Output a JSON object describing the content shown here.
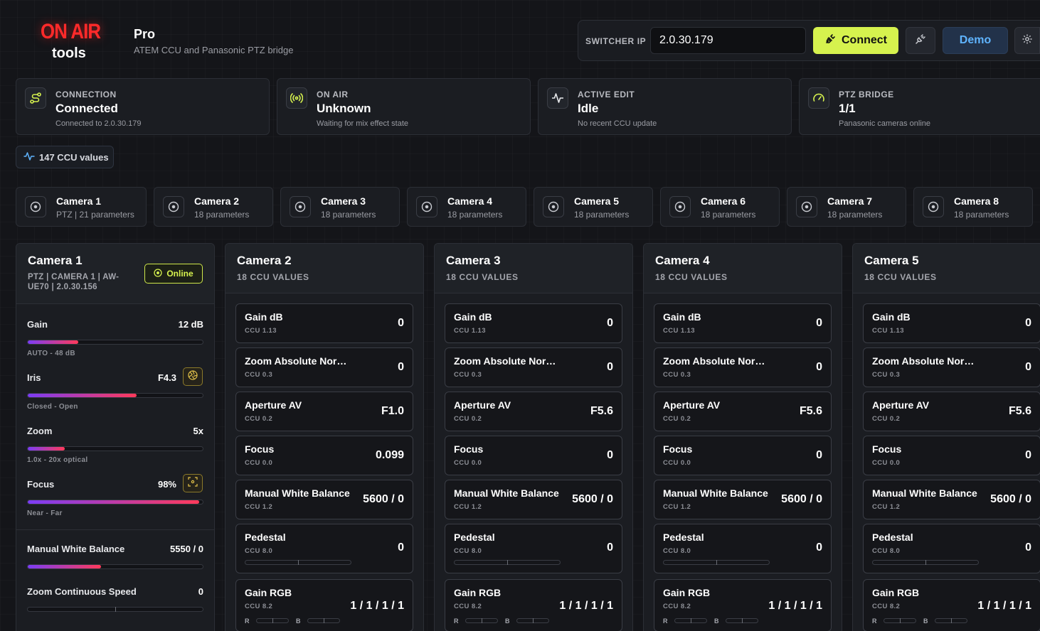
{
  "logo": {
    "top": "ON AIR",
    "bottom": "tools"
  },
  "app": {
    "title": "Pro",
    "subtitle": "ATEM CCU and Panasonic PTZ bridge"
  },
  "connection_bar": {
    "label": "SWITCHER IP",
    "ip_value": "2.0.30.179",
    "connect_label": "Connect",
    "demo_label": "Demo"
  },
  "status": [
    {
      "label": "CONNECTION",
      "value": "Connected",
      "sub": "Connected to 2.0.30.179",
      "icon": "route-icon"
    },
    {
      "label": "ON AIR",
      "value": "Unknown",
      "sub": "Waiting for mix effect state",
      "icon": "broadcast-icon"
    },
    {
      "label": "ACTIVE EDIT",
      "value": "Idle",
      "sub": "No recent CCU update",
      "icon": "activity-icon"
    },
    {
      "label": "PTZ BRIDGE",
      "value": "1/1",
      "sub": "Panasonic cameras online",
      "icon": "gauge-icon"
    }
  ],
  "ccu_count": "147 CCU values",
  "tabs": [
    {
      "name": "Camera 1",
      "params": "PTZ | 21 parameters"
    },
    {
      "name": "Camera 2",
      "params": "18 parameters"
    },
    {
      "name": "Camera 3",
      "params": "18 parameters"
    },
    {
      "name": "Camera 4",
      "params": "18 parameters"
    },
    {
      "name": "Camera 5",
      "params": "18 parameters"
    },
    {
      "name": "Camera 6",
      "params": "18 parameters"
    },
    {
      "name": "Camera 7",
      "params": "18 parameters"
    },
    {
      "name": "Camera 8",
      "params": "18 parameters"
    }
  ],
  "camera1": {
    "name": "Camera 1",
    "meta": "PTZ | CAMERA 1 | AW-UE70 | 2.0.30.156",
    "status": "Online",
    "controls": [
      {
        "label": "Gain",
        "value": "12 dB",
        "sub": "AUTO - 48 dB",
        "level": 0.29
      },
      {
        "label": "Iris",
        "value": "F4.3",
        "sub": "Closed - Open",
        "level": 0.62
      },
      {
        "label": "Zoom",
        "value": "5x",
        "sub": "1.0x - 20x optical",
        "level": 0.21
      },
      {
        "label": "Focus",
        "value": "98%",
        "sub": "Near - Far",
        "level": 0.98
      }
    ],
    "extra": [
      {
        "label": "Manual White Balance",
        "value": "5550 / 0",
        "level": 0.42
      },
      {
        "label": "Zoom Continuous Speed",
        "value": "0"
      }
    ]
  },
  "panels": [
    {
      "name": "Camera 2",
      "meta": "18 CCU VALUES",
      "rows": [
        {
          "name": "Gain dB",
          "ccu": "CCU 1.13",
          "value": "0"
        },
        {
          "name": "Zoom Absolute Normalized",
          "ccu": "CCU 0.3",
          "value": "0"
        },
        {
          "name": "Aperture AV",
          "ccu": "CCU 0.2",
          "value": "F1.0"
        },
        {
          "name": "Focus",
          "ccu": "CCU 0.0",
          "value": "0.099"
        },
        {
          "name": "Manual White Balance",
          "ccu": "CCU 1.2",
          "value": "5600 / 0"
        },
        {
          "name": "Pedestal",
          "ccu": "CCU 8.0",
          "value": "0"
        },
        {
          "name": "Gain RGB",
          "ccu": "CCU 8.2",
          "value": "1 / 1 / 1 / 1"
        }
      ]
    },
    {
      "name": "Camera 3",
      "meta": "18 CCU VALUES",
      "rows": [
        {
          "name": "Gain dB",
          "ccu": "CCU 1.13",
          "value": "0"
        },
        {
          "name": "Zoom Absolute Normalized",
          "ccu": "CCU 0.3",
          "value": "0"
        },
        {
          "name": "Aperture AV",
          "ccu": "CCU 0.2",
          "value": "F5.6"
        },
        {
          "name": "Focus",
          "ccu": "CCU 0.0",
          "value": "0"
        },
        {
          "name": "Manual White Balance",
          "ccu": "CCU 1.2",
          "value": "5600 / 0"
        },
        {
          "name": "Pedestal",
          "ccu": "CCU 8.0",
          "value": "0"
        },
        {
          "name": "Gain RGB",
          "ccu": "CCU 8.2",
          "value": "1 / 1 / 1 / 1"
        }
      ]
    },
    {
      "name": "Camera 4",
      "meta": "18 CCU VALUES",
      "rows": [
        {
          "name": "Gain dB",
          "ccu": "CCU 1.13",
          "value": "0"
        },
        {
          "name": "Zoom Absolute Normalized",
          "ccu": "CCU 0.3",
          "value": "0"
        },
        {
          "name": "Aperture AV",
          "ccu": "CCU 0.2",
          "value": "F5.6"
        },
        {
          "name": "Focus",
          "ccu": "CCU 0.0",
          "value": "0"
        },
        {
          "name": "Manual White Balance",
          "ccu": "CCU 1.2",
          "value": "5600 / 0"
        },
        {
          "name": "Pedestal",
          "ccu": "CCU 8.0",
          "value": "0"
        },
        {
          "name": "Gain RGB",
          "ccu": "CCU 8.2",
          "value": "1 / 1 / 1 / 1"
        }
      ]
    },
    {
      "name": "Camera 5",
      "meta": "18 CCU VALUES",
      "rows": [
        {
          "name": "Gain dB",
          "ccu": "CCU 1.13",
          "value": "0"
        },
        {
          "name": "Zoom Absolute Normalized",
          "ccu": "CCU 0.3",
          "value": "0"
        },
        {
          "name": "Aperture AV",
          "ccu": "CCU 0.2",
          "value": "F5.6"
        },
        {
          "name": "Focus",
          "ccu": "CCU 0.0",
          "value": "0"
        },
        {
          "name": "Manual White Balance",
          "ccu": "CCU 1.2",
          "value": "5600 / 0"
        },
        {
          "name": "Pedestal",
          "ccu": "CCU 8.0",
          "value": "0"
        },
        {
          "name": "Gain RGB",
          "ccu": "CCU 8.2",
          "value": "1 / 1 / 1 / 1"
        }
      ]
    }
  ],
  "rgb_letters": {
    "r": "R",
    "b": "B"
  },
  "colors": {
    "accent": "#d6f24e",
    "on_air": "#ff2a2a",
    "demo": "#5fb4ff"
  }
}
